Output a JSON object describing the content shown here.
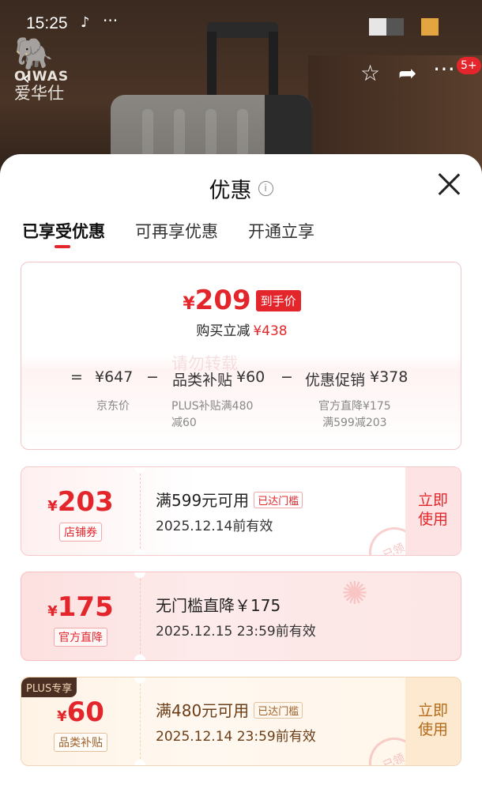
{
  "status_bar": {
    "time": "15:25",
    "more": "···"
  },
  "background": {
    "brand_latin": "OIWAS",
    "brand_cn": "爱华仕",
    "notification_count": "5+"
  },
  "sheet": {
    "title": "优惠",
    "tabs": [
      {
        "label": "已享受优惠",
        "active": true
      },
      {
        "label": "可再享优惠",
        "active": false
      },
      {
        "label": "开通立享",
        "active": false
      }
    ]
  },
  "summary": {
    "currency": "¥",
    "final_price": "209",
    "final_price_tag": "到手价",
    "reduce_label": "购买立减",
    "reduce_value": "¥438",
    "watermark": "请勿转载",
    "formula": {
      "eq": "=",
      "jd_price": "¥647",
      "minus1": "−",
      "category_label": "品类补贴",
      "category_value": "¥60",
      "minus2": "−",
      "promo_label": "优惠促销",
      "promo_value": "¥378"
    },
    "subs": {
      "jd_price_label": "京东价",
      "category_sub_line1": "PLUS补贴满480",
      "category_sub_line2": "减60",
      "promo_sub_line1": "官方直降¥175",
      "promo_sub_line2": "满599减203"
    }
  },
  "coupons": [
    {
      "currency": "¥",
      "amount": "203",
      "kind": "店铺券",
      "condition": "满599元可用",
      "met_tag": "已达门槛",
      "validity": "2025.12.14前有效",
      "action": "立即使用",
      "stamp": "已领"
    },
    {
      "currency": "¥",
      "amount": "175",
      "kind": "官方直降",
      "condition": "无门槛直降￥175",
      "validity": "2025.12.15 23:59前有效"
    },
    {
      "plus_tag": "PLUS专享",
      "currency": "¥",
      "amount": "60",
      "kind": "品类补贴",
      "condition": "满480元可用",
      "met_tag": "已达门槛",
      "validity": "2025.12.14 23:59前有效",
      "action": "立即使用",
      "stamp": "已领"
    }
  ],
  "colors": {
    "accent": "#e3262b",
    "plus_dark": "#4a2f22"
  }
}
